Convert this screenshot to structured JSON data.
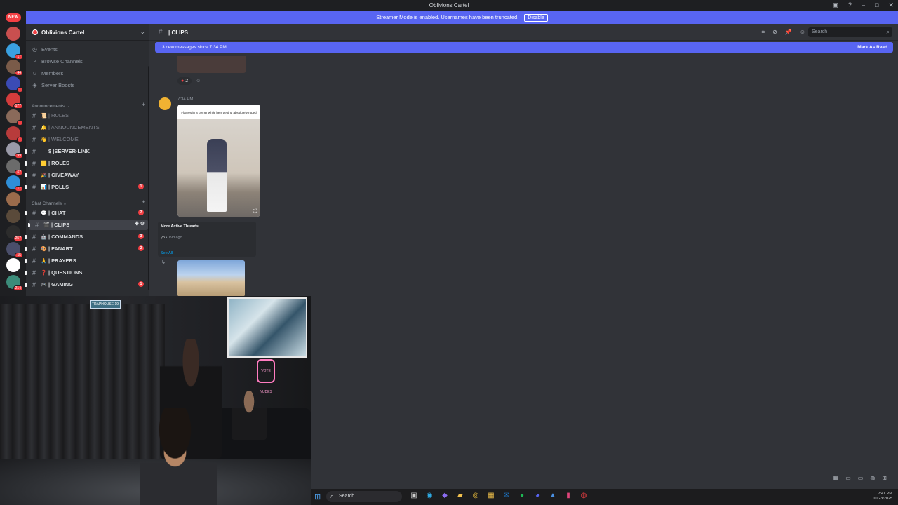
{
  "window": {
    "title": "Oblivions Cartel"
  },
  "banner": {
    "text": "Streamer Mode is enabled. Usernames have been truncated.",
    "disable_label": "Disable",
    "new_badge": "NEW"
  },
  "servers": [
    {
      "color": "#c94f4f",
      "count": ""
    },
    {
      "color": "#3aa0e0",
      "count": "17"
    },
    {
      "color": "#7a5b49",
      "count": "44"
    },
    {
      "color": "#3b4bb5",
      "count": "1"
    },
    {
      "color": "#d43c3c",
      "count": "177"
    },
    {
      "color": "#8a6a5a",
      "count": "1"
    },
    {
      "color": "#b83b3b",
      "count": "1"
    },
    {
      "color": "#9a9aa8",
      "count": "99"
    },
    {
      "color": "#6b6b6b",
      "count": "67"
    },
    {
      "color": "#2f8fd8",
      "count": "17"
    },
    {
      "color": "#9b6b4b",
      "count": ""
    },
    {
      "color": "#5a4a3a",
      "count": ""
    },
    {
      "color": "#2c2c2c",
      "count": "257"
    },
    {
      "color": "#4a4e6a",
      "count": "15"
    },
    {
      "color": "#ffffff",
      "count": ""
    },
    {
      "color": "#3c8c7a",
      "count": "214"
    }
  ],
  "sidebar": {
    "server_name": "Oblivions Cartel",
    "nav": [
      {
        "icon": "◷",
        "label": "Events"
      },
      {
        "icon": "⌕",
        "label": "Browse Channels"
      },
      {
        "icon": "☺",
        "label": "Members"
      },
      {
        "icon": "◈",
        "label": "Server Boosts"
      }
    ],
    "cat_announcements": "Announcements ⌄",
    "cat_chat": "Chat Channels ⌄",
    "channels_a": [
      {
        "emoji": "📜",
        "label": "| RULES",
        "muted": true,
        "badge": ""
      },
      {
        "emoji": "🔔",
        "label": "| ANNOUNCEMENTS",
        "muted": true,
        "badge": ""
      },
      {
        "emoji": "👋",
        "label": "| WELCOME",
        "muted": true,
        "badge": ""
      },
      {
        "emoji": "",
        "label": "$ |SERVER-LINK",
        "muted": false,
        "badge": ""
      },
      {
        "emoji": "🟨",
        "label": "| ROLES",
        "muted": false,
        "badge": ""
      },
      {
        "emoji": "🎉",
        "label": "| GIVEAWAY",
        "muted": false,
        "badge": ""
      },
      {
        "emoji": "📊",
        "label": "| POLLS",
        "muted": false,
        "badge": "1"
      }
    ],
    "channels_b": [
      {
        "emoji": "💬",
        "label": "| CHAT",
        "muted": false,
        "badge": "2"
      },
      {
        "emoji": "🎬",
        "label": "| CLIPS",
        "muted": false,
        "badge": "",
        "active": true
      },
      {
        "emoji": "🤖",
        "label": "| COMMANDS",
        "muted": false,
        "badge": "3"
      },
      {
        "emoji": "🎨",
        "label": "| FANART",
        "muted": false,
        "badge": "2"
      },
      {
        "emoji": "🙏",
        "label": "| PRAYERS",
        "muted": false,
        "badge": ""
      },
      {
        "emoji": "❓",
        "label": "| QUESTIONS",
        "muted": false,
        "badge": ""
      },
      {
        "emoji": "🎮",
        "label": "| GAMING",
        "muted": false,
        "badge": "1"
      }
    ]
  },
  "header": {
    "channel": "| CLIPS",
    "search_placeholder": "Search"
  },
  "newmsg": {
    "text": "3 new messages since 7:34 PM",
    "mark": "Mark As Read"
  },
  "messages": {
    "reaction_count": "2",
    "meta": "7:34 PM",
    "caption": "Flames in a corner while he's getting absolutely roped"
  },
  "threads": {
    "title": "More Active Threads",
    "item_name": "yo",
    "item_time": "• 19d ago",
    "see_all": "See All"
  },
  "webcam": {
    "sign": "TRAPHOUSE 19",
    "neon": "VOTE NUDES"
  },
  "taskbar": {
    "search": "Search",
    "time": "7:41 PM",
    "date": "10/23/2025"
  },
  "colors": {
    "accent": "#5865f2",
    "danger": "#f23f43"
  }
}
